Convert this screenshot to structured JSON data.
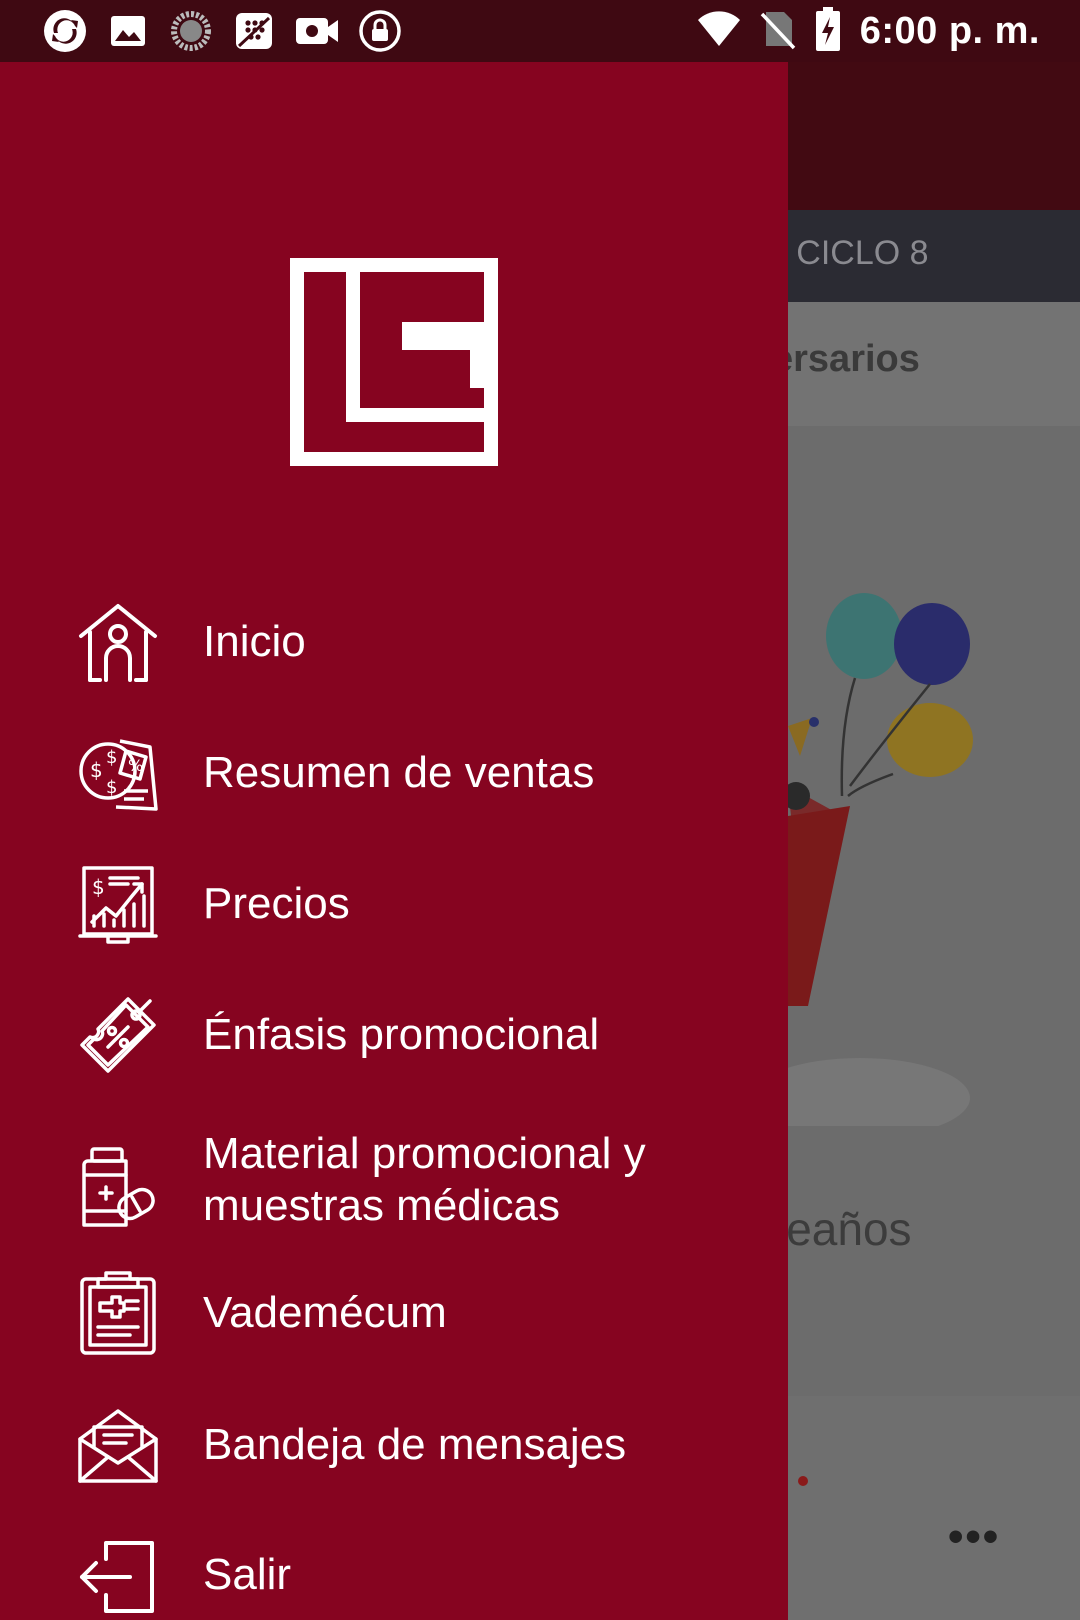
{
  "status_bar": {
    "time": "6:00 p. m.",
    "left_icons": [
      "sync-icon",
      "image-icon",
      "loading-icon",
      "blackberry-icon",
      "video-camera-icon",
      "lock-circle-icon"
    ],
    "right_icons": [
      "wifi-icon",
      "no-sim-icon",
      "battery-charging-icon"
    ]
  },
  "background_app": {
    "cycle_text": "| CICLO 8",
    "tab_text": "ersarios",
    "card_text": "leaños",
    "more_glyph": "•••"
  },
  "drawer": {
    "logo": "company-logo",
    "menu": [
      {
        "label": "Inicio",
        "icon": "home-icon"
      },
      {
        "label": "Resumen de ventas",
        "icon": "sales-summary-icon"
      },
      {
        "label": "Precios",
        "icon": "prices-chart-icon"
      },
      {
        "label": "Énfasis promocional",
        "icon": "promo-tag-icon"
      },
      {
        "label": "Material promocional y",
        "label_line2": "muestras médicas",
        "icon": "medicine-bottle-icon"
      },
      {
        "label": "Vademécum",
        "icon": "clipboard-medical-icon"
      },
      {
        "label": "Bandeja de mensajes",
        "icon": "mail-open-icon"
      },
      {
        "label": "Salir",
        "icon": "logout-icon"
      }
    ]
  },
  "colors": {
    "drawer_bg": "#860420",
    "status_bar_bg": "#3f0912",
    "menu_text": "#ffffff"
  }
}
